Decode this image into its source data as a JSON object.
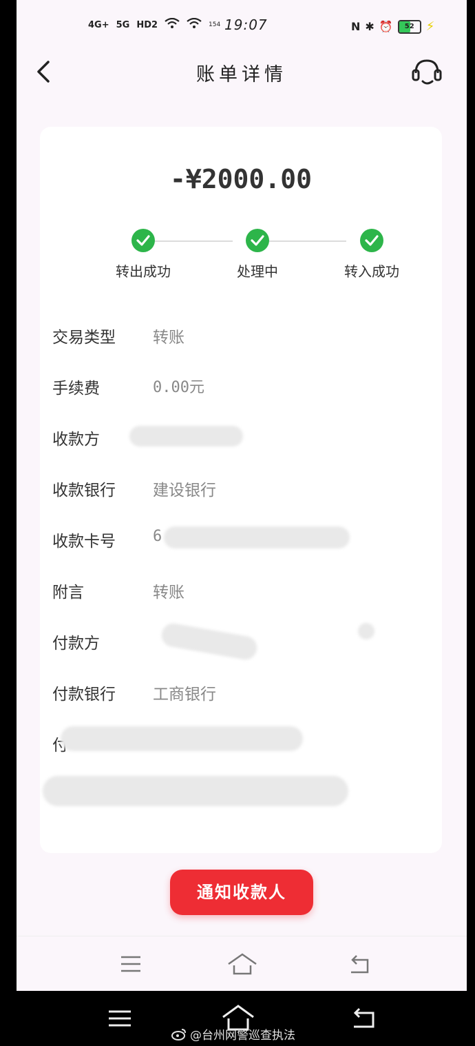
{
  "status_bar": {
    "network": [
      "4G+",
      "5G",
      "HD2"
    ],
    "speed": "154",
    "time": "19:07",
    "battery": "52",
    "icons": [
      "signal-icon",
      "wifi-icon",
      "nfc-icon",
      "bluetooth-icon",
      "alarm-icon",
      "battery-icon",
      "charging-icon"
    ]
  },
  "header": {
    "title": "账单详情",
    "back_icon": "chevron-left-icon",
    "service_icon": "headset-icon"
  },
  "amount": "-¥2000.00",
  "progress": {
    "steps": [
      {
        "label": "转出成功",
        "done": true
      },
      {
        "label": "处理中",
        "done": true
      },
      {
        "label": "转入成功",
        "done": true
      }
    ],
    "accent_color": "#2db54a"
  },
  "details": {
    "rows": [
      {
        "label": "交易类型",
        "value": "转账"
      },
      {
        "label": "手续费",
        "value": "0.00元"
      },
      {
        "label": "收款方",
        "value": ""
      },
      {
        "label": "收款银行",
        "value": "建设银行"
      },
      {
        "label": "收款卡号",
        "value": "6"
      },
      {
        "label": "附言",
        "value": "转账"
      },
      {
        "label": "付款方",
        "value": ""
      },
      {
        "label": "付款银行",
        "value": "工商银行"
      },
      {
        "label": "付",
        "value": ""
      }
    ]
  },
  "notify_button": {
    "label": "通知收款人",
    "color": "#ee2d34"
  },
  "nav": {
    "icons": [
      "menu-icon",
      "home-icon",
      "back-icon"
    ]
  },
  "watermark": "@台州网警巡查执法"
}
